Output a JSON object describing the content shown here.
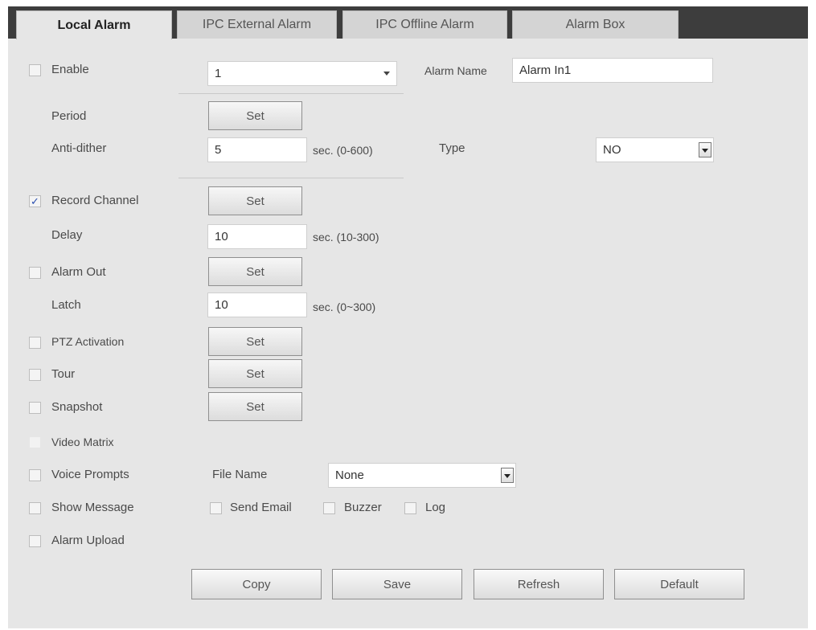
{
  "tabs": [
    {
      "label": "Local Alarm",
      "active": true
    },
    {
      "label": "IPC External Alarm",
      "active": false
    },
    {
      "label": "IPC Offline Alarm",
      "active": false
    },
    {
      "label": "Alarm Box",
      "active": false
    }
  ],
  "enable": {
    "label": "Enable",
    "checked": false,
    "channel_value": "1"
  },
  "alarm_name": {
    "label": "Alarm Name",
    "value": "Alarm In1"
  },
  "period": {
    "label": "Period",
    "button": "Set"
  },
  "anti_dither": {
    "label": "Anti-dither",
    "value": "5",
    "unit": "sec. (0-600)"
  },
  "type": {
    "label": "Type",
    "value": "NO"
  },
  "record_channel": {
    "label": "Record Channel",
    "checked": true,
    "button": "Set"
  },
  "delay": {
    "label": "Delay",
    "value": "10",
    "unit": "sec. (10-300)"
  },
  "alarm_out": {
    "label": "Alarm Out",
    "checked": false,
    "button": "Set"
  },
  "latch": {
    "label": "Latch",
    "value": "10",
    "unit": "sec. (0~300)"
  },
  "ptz_activation": {
    "label": "PTZ Activation",
    "checked": false,
    "button": "Set"
  },
  "tour": {
    "label": "Tour",
    "checked": false,
    "button": "Set"
  },
  "snapshot": {
    "label": "Snapshot",
    "checked": false,
    "button": "Set"
  },
  "video_matrix": {
    "label": "Video Matrix",
    "checked": false
  },
  "voice_prompts": {
    "label": "Voice Prompts",
    "checked": false,
    "file_name_label": "File Name",
    "file_name_value": "None"
  },
  "show_message": {
    "label": "Show Message",
    "checked": false
  },
  "send_email": {
    "label": "Send Email",
    "checked": false
  },
  "buzzer": {
    "label": "Buzzer",
    "checked": false
  },
  "log": {
    "label": "Log",
    "checked": false
  },
  "alarm_upload": {
    "label": "Alarm Upload",
    "checked": false
  },
  "actions": {
    "copy": "Copy",
    "save": "Save",
    "refresh": "Refresh",
    "default": "Default"
  },
  "icons": {
    "check_mark": "✓"
  },
  "colors": {
    "tab_bar": "#3d3d3d",
    "panel": "#e6e6e6",
    "check": "#2a4fb0"
  }
}
